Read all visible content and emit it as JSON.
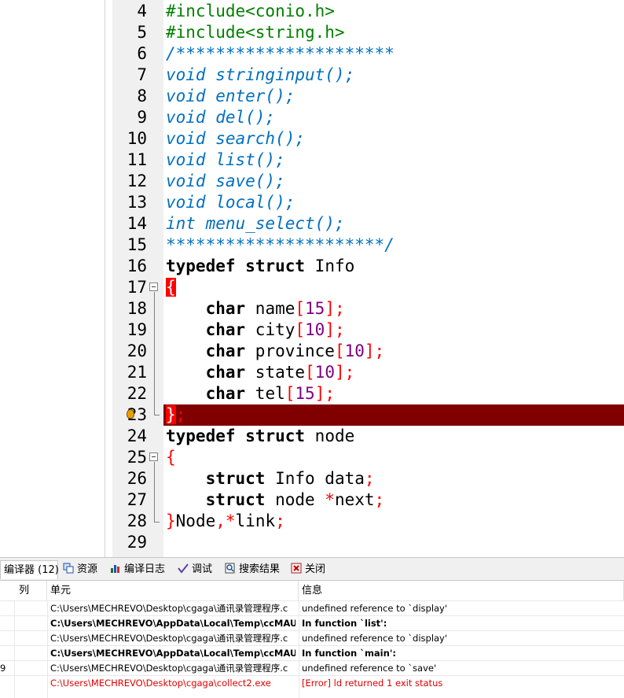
{
  "editor": {
    "lines": [
      {
        "n": "4",
        "code": [
          {
            "t": "#include<conio.h>",
            "c": "pp"
          }
        ]
      },
      {
        "n": "5",
        "code": [
          {
            "t": "#include<string.h>",
            "c": "pp"
          }
        ]
      },
      {
        "n": "6",
        "code": [
          {
            "t": "/**********************",
            "c": "cm"
          }
        ]
      },
      {
        "n": "7",
        "code": [
          {
            "t": "void stringinput();",
            "c": "cm"
          }
        ]
      },
      {
        "n": "8",
        "code": [
          {
            "t": "void enter();",
            "c": "cm"
          }
        ]
      },
      {
        "n": "9",
        "code": [
          {
            "t": "void del();",
            "c": "cm"
          }
        ]
      },
      {
        "n": "10",
        "code": [
          {
            "t": "void search();",
            "c": "cm"
          }
        ]
      },
      {
        "n": "11",
        "code": [
          {
            "t": "void list();",
            "c": "cm"
          }
        ]
      },
      {
        "n": "12",
        "code": [
          {
            "t": "void save();",
            "c": "cm"
          }
        ]
      },
      {
        "n": "13",
        "code": [
          {
            "t": "void local();",
            "c": "cm"
          }
        ]
      },
      {
        "n": "14",
        "code": [
          {
            "t": "int menu_select();",
            "c": "cm"
          }
        ]
      },
      {
        "n": "15",
        "code": [
          {
            "t": "**********************/",
            "c": "cm"
          }
        ]
      },
      {
        "n": "16",
        "code": [
          {
            "t": "typedef",
            "c": "kw"
          },
          {
            "t": " "
          },
          {
            "t": "struct",
            "c": "kw"
          },
          {
            "t": " Info"
          }
        ]
      },
      {
        "n": "17",
        "code": [
          {
            "t": "{",
            "c": "brace-hl"
          }
        ]
      },
      {
        "n": "18",
        "code": [
          {
            "t": "    "
          },
          {
            "t": "char",
            "c": "kw"
          },
          {
            "t": " name"
          },
          {
            "t": "[",
            "c": "sym"
          },
          {
            "t": "15",
            "c": "num"
          },
          {
            "t": "];",
            "c": "sym"
          }
        ]
      },
      {
        "n": "19",
        "code": [
          {
            "t": "    "
          },
          {
            "t": "char",
            "c": "kw"
          },
          {
            "t": " city"
          },
          {
            "t": "[",
            "c": "sym"
          },
          {
            "t": "10",
            "c": "num"
          },
          {
            "t": "];",
            "c": "sym"
          }
        ]
      },
      {
        "n": "20",
        "code": [
          {
            "t": "    "
          },
          {
            "t": "char",
            "c": "kw"
          },
          {
            "t": " province"
          },
          {
            "t": "[",
            "c": "sym"
          },
          {
            "t": "10",
            "c": "num"
          },
          {
            "t": "];",
            "c": "sym"
          }
        ]
      },
      {
        "n": "21",
        "code": [
          {
            "t": "    "
          },
          {
            "t": "char",
            "c": "kw"
          },
          {
            "t": " state"
          },
          {
            "t": "[",
            "c": "sym"
          },
          {
            "t": "10",
            "c": "num"
          },
          {
            "t": "];",
            "c": "sym"
          }
        ]
      },
      {
        "n": "22",
        "code": [
          {
            "t": "    "
          },
          {
            "t": "char",
            "c": "kw"
          },
          {
            "t": " tel"
          },
          {
            "t": "[",
            "c": "sym"
          },
          {
            "t": "15",
            "c": "num"
          },
          {
            "t": "];",
            "c": "sym"
          }
        ]
      },
      {
        "n": "23",
        "code": [
          {
            "t": "}",
            "c": "brace-hl"
          },
          {
            "t": ";",
            "c": "sym"
          }
        ]
      },
      {
        "n": "24",
        "code": [
          {
            "t": "typedef",
            "c": "kw"
          },
          {
            "t": " "
          },
          {
            "t": "struct",
            "c": "kw"
          },
          {
            "t": " node"
          }
        ]
      },
      {
        "n": "25",
        "code": [
          {
            "t": "{",
            "c": "sym"
          }
        ]
      },
      {
        "n": "26",
        "code": [
          {
            "t": "    "
          },
          {
            "t": "struct",
            "c": "kw"
          },
          {
            "t": " Info data"
          },
          {
            "t": ";",
            "c": "sym"
          }
        ]
      },
      {
        "n": "27",
        "code": [
          {
            "t": "    "
          },
          {
            "t": "struct",
            "c": "kw"
          },
          {
            "t": " node "
          },
          {
            "t": "*",
            "c": "sym"
          },
          {
            "t": "next"
          },
          {
            "t": ";",
            "c": "sym"
          }
        ]
      },
      {
        "n": "28",
        "code": [
          {
            "t": "}",
            "c": "sym"
          },
          {
            "t": "Node"
          },
          {
            "t": ",*",
            "c": "sym"
          },
          {
            "t": "link"
          },
          {
            "t": ";",
            "c": "sym"
          }
        ]
      },
      {
        "n": "29",
        "code": []
      }
    ]
  },
  "tabs": [
    {
      "label": "编译器 (12)",
      "icon": "compiler-icon"
    },
    {
      "label": "资源",
      "icon": "resources-icon"
    },
    {
      "label": "编译日志",
      "icon": "compile-log-icon"
    },
    {
      "label": "调试",
      "icon": "debug-icon"
    },
    {
      "label": "搜索结果",
      "icon": "search-results-icon"
    },
    {
      "label": "关闭",
      "icon": "close-icon"
    }
  ],
  "table": {
    "headers": {
      "col": "列",
      "unit": "单元",
      "message": "信息"
    },
    "rows": [
      {
        "col": "",
        "unit": "C:\\Users\\MECHREVO\\Desktop\\cgaga\\通讯录管理程序.c",
        "message": "undefined reference to `display'",
        "style": "normal"
      },
      {
        "col": "",
        "unit": "C:\\Users\\MECHREVO\\AppData\\Local\\Temp\\ccMAUezl.o",
        "message": "In function `list':",
        "style": "bold"
      },
      {
        "col": "",
        "unit": "C:\\Users\\MECHREVO\\Desktop\\cgaga\\通讯录管理程序.c",
        "message": "undefined reference to `display'",
        "style": "normal"
      },
      {
        "col": "",
        "unit": "C:\\Users\\MECHREVO\\AppData\\Local\\Temp\\ccMAUezl.o",
        "message": "In function `main':",
        "style": "bold"
      },
      {
        "col": "9",
        "unit": "C:\\Users\\MECHREVO\\Desktop\\cgaga\\通讯录管理程序.c",
        "message": "undefined reference to `save'",
        "style": "normal"
      },
      {
        "col": "",
        "unit": "C:\\Users\\MECHREVO\\Desktop\\cgaga\\collect2.exe",
        "message": "[Error] ld returned 1 exit status",
        "style": "red"
      }
    ]
  }
}
